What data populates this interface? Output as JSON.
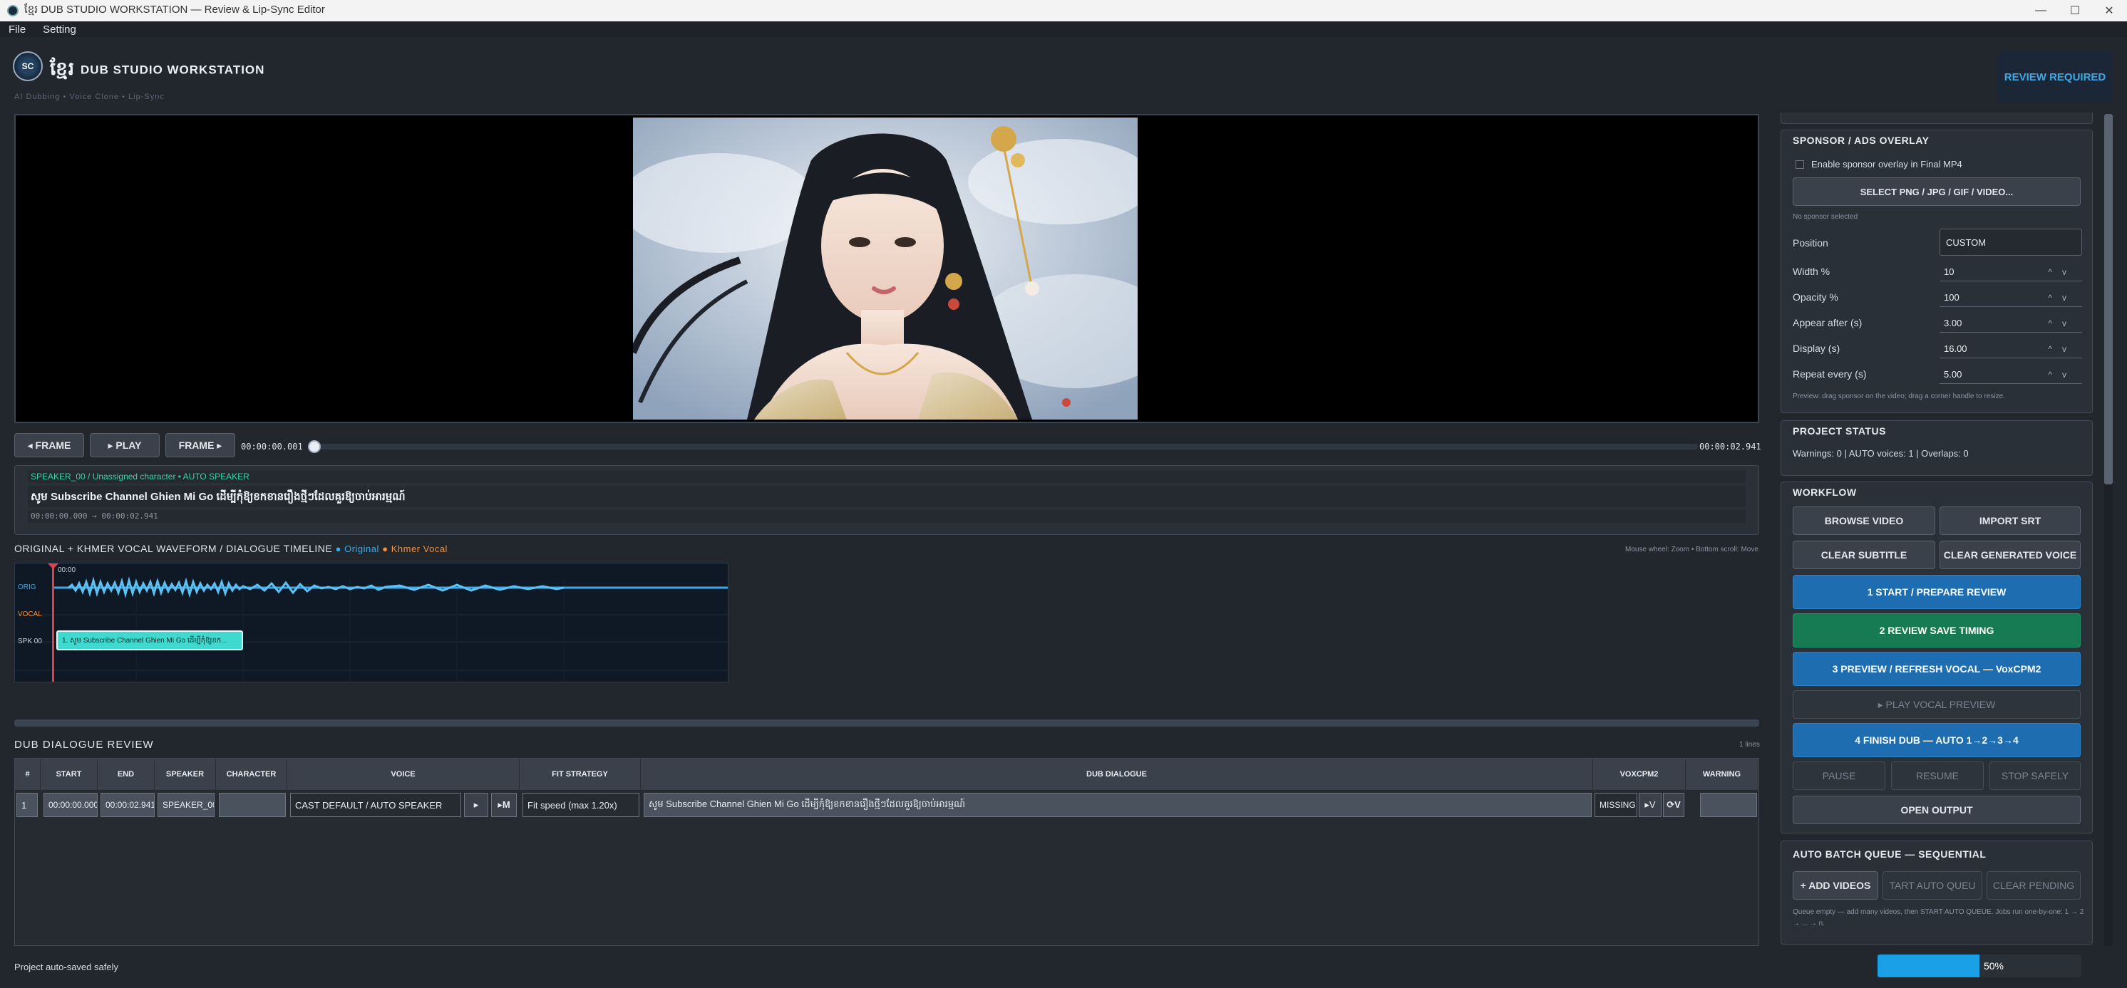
{
  "window": {
    "title": "ខ្មែរ DUB STUDIO WORKSTATION — Review & Lip-Sync Editor"
  },
  "menu": [
    "File",
    "Setting"
  ],
  "header": {
    "logo_text": "SC",
    "title_kh": "ខ្មែរ",
    "title": "DUB STUDIO WORKSTATION",
    "tagline": "AI Dubbing  •  Voice Clone  •  Lip-Sync",
    "badge": "REVIEW REQUIRED"
  },
  "player": {
    "frame_back": "◂ FRAME",
    "play": "▸ PLAY",
    "frame_fwd": "FRAME ▸",
    "time_current": "00:00:00.001",
    "time_total": "00:00:02.941",
    "progress": 0.0
  },
  "segment": {
    "header": "SPEAKER_00  /  Unassigned character  •  AUTO SPEAKER",
    "text": "សូម Subscribe Channel Ghien Mi Go ដើម្បីកុំឱ្យខកខានរឿងថ្មីៗដែលគួរឱ្យចាប់អារម្មណ៍",
    "range": "00:00:00.000  →  00:00:02.941"
  },
  "waveform": {
    "title": "ORIGINAL + KHMER VOCAL WAVEFORM / DIALOGUE TIMELINE",
    "legend_original": "● Original",
    "legend_vocal": "● Khmer Vocal",
    "hint": "Mouse wheel: Zoom  •  Bottom scroll: Move",
    "tick": "00:00",
    "lanes": [
      "ORIG",
      "VOCAL",
      "SPK 00"
    ],
    "clip": "1. សូម Subscribe Channel Ghien Mi Go ដើម្បីកុំឱ្យខក..."
  },
  "review": {
    "title": "DUB DIALOGUE REVIEW",
    "count": "1 lines",
    "columns": [
      "#",
      "START",
      "END",
      "SPEAKER",
      "CHARACTER",
      "VOICE",
      "FIT STRATEGY",
      "DUB DIALOGUE",
      "VOXCPM2",
      "WARNING"
    ],
    "rows": [
      {
        "num": "1",
        "start": "00:00:00.000",
        "end": "00:00:02.941",
        "speaker": "SPEAKER_00",
        "character": "",
        "voice": "CAST DEFAULT / AUTO SPEAKER",
        "play": "▸",
        "mic": "▸M",
        "fit": "Fit speed (max 1.20x)",
        "dialogue": "សូម Subscribe Channel Ghien Mi Go ដើម្បីកុំឱ្យខកខានរឿងថ្មីៗដែលគួរឱ្យចាប់អារម្មណ៍",
        "vox": "MISSING",
        "vox_play": "▸V",
        "vox_regen": "⟳V",
        "warning": ""
      }
    ]
  },
  "sponsor": {
    "title": "SPONSOR / ADS OVERLAY",
    "enable_label": "Enable sponsor overlay in Final MP4",
    "enabled": false,
    "select_button": "SELECT PNG / JPG / GIF / VIDEO...",
    "none_selected": "No sponsor selected",
    "position_label": "Position",
    "position_value": "CUSTOM",
    "fields": [
      {
        "label": "Width %",
        "value": "10"
      },
      {
        "label": "Opacity %",
        "value": "100"
      },
      {
        "label": "Appear after (s)",
        "value": "3.00"
      },
      {
        "label": "Display (s)",
        "value": "16.00"
      },
      {
        "label": "Repeat every (s)",
        "value": "5.00"
      }
    ],
    "hint": "Preview: drag sponsor on the video; drag a corner handle to resize."
  },
  "project_status": {
    "title": "PROJECT STATUS",
    "text": "Warnings: 0  |  AUTO voices: 1  |  Overlaps: 0"
  },
  "workflow": {
    "title": "WORKFLOW",
    "browse": "BROWSE VIDEO",
    "import_srt": "IMPORT SRT",
    "clear_subtitle": "CLEAR SUBTITLE",
    "clear_voice": "CLEAR GENERATED VOICE",
    "step1": "1  START / PREPARE REVIEW",
    "step2": "2  REVIEW  SAVE TIMING",
    "step3": "3  PREVIEW / REFRESH VOCAL — VoxCPM2",
    "play_preview": "▸ PLAY VOCAL PREVIEW",
    "step4": "4  FINISH DUB — AUTO 1→2→3→4",
    "pause": "PAUSE",
    "resume": "RESUME",
    "stop": "STOP SAFELY",
    "open_output": "OPEN OUTPUT"
  },
  "batch": {
    "title": "AUTO BATCH QUEUE — SEQUENTIAL",
    "add": "+ ADD VIDEOS",
    "start": "TART AUTO QUEU",
    "clear": "CLEAR PENDING",
    "hint": "Queue empty — add many videos, then START AUTO QUEUE. Jobs run one-by-one: 1 → 2 → ... → n."
  },
  "statusbar": {
    "text": "Project auto-saved safely",
    "progress_label": "50%",
    "progress": 0.5
  },
  "colors": {
    "accent_blue": "#1e6db0",
    "accent_green": "#167a52",
    "legend_original": "#3fa9e6",
    "legend_vocal": "#f0913a",
    "clip": "#3fd9cf",
    "segment_header": "#39d3a8"
  }
}
